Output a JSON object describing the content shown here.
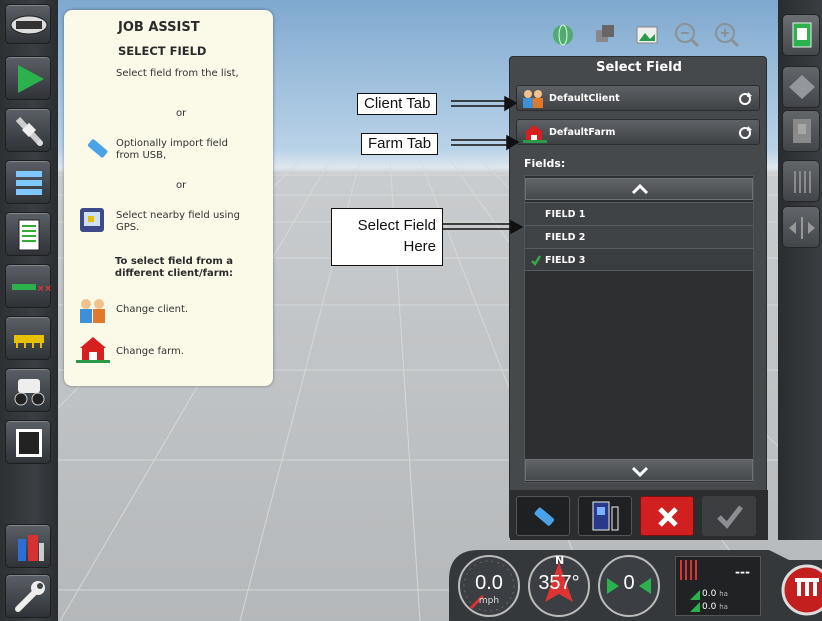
{
  "job_assist": {
    "title": "JOB ASSIST",
    "subtitle": "SELECT FIELD",
    "instruction_1": "Select field from the list,",
    "or_1": "or",
    "usb_line_1": "Optionally import field",
    "usb_line_2": "from USB,",
    "or_2": "or",
    "gps_line_1": "Select nearby field using",
    "gps_line_2": "GPS.",
    "different_line_1": "To select field from a",
    "different_line_2": "different client/farm:",
    "change_client": "Change client.",
    "change_farm": "Change farm."
  },
  "dialog": {
    "title": "Select Field",
    "client_value": "DefaultClient",
    "farm_value": "DefaultFarm",
    "fields_label": "Fields:",
    "fields": [
      {
        "name": "FIELD 1",
        "selected": false
      },
      {
        "name": "FIELD 2",
        "selected": false
      },
      {
        "name": "FIELD 3",
        "selected": true
      }
    ]
  },
  "annotations": {
    "client_tab": "Client Tab",
    "farm_tab": "Farm Tab",
    "select_field_line_1": "Select Field",
    "select_field_line_2": "Here"
  },
  "status": {
    "speed": "0.0",
    "speed_unit": "mph",
    "heading": "357°",
    "heading_cardinal": "N",
    "steer": "0",
    "area_dash": "---",
    "area_1": "0.0",
    "area_1_unit": "ha",
    "area_2": "0.0",
    "area_2_unit": "ha"
  },
  "colors": {
    "accent_green": "#3aa64a",
    "cancel_red": "#d02020",
    "dialog_bg": "#46494c",
    "assist_bg": "#fbf9e8"
  },
  "icons": {
    "left_bar": [
      "logo-icon",
      "play-icon",
      "satellite-icon",
      "bars-icon",
      "notepad-icon",
      "boom-icon",
      "implement-icon",
      "tractor-icon",
      "film-icon",
      "trash-icon",
      "wrench-icon"
    ],
    "right_bar": [
      "book-icon",
      "layers-icon",
      "page-icon",
      "rows-icon",
      "arrows-icon"
    ]
  }
}
